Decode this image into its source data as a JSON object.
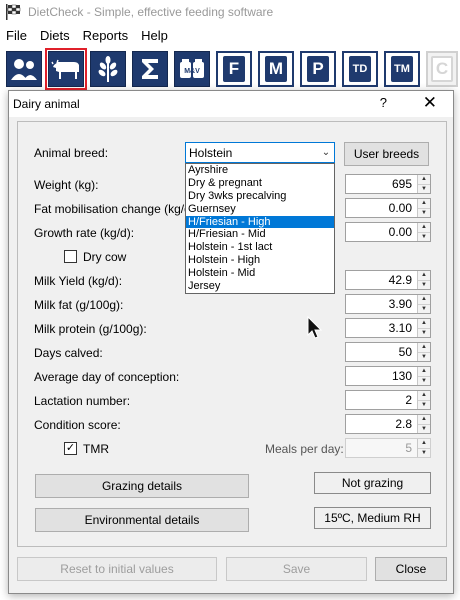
{
  "app": {
    "title": "DietCheck - Simple, effective feeding software",
    "menu": [
      "File",
      "Diets",
      "Reports",
      "Help"
    ]
  },
  "toolbar": {
    "buttons": [
      {
        "name": "users-icon"
      },
      {
        "name": "cow-icon",
        "selected": true
      },
      {
        "name": "crop-icon"
      },
      {
        "name": "sigma-icon"
      },
      {
        "name": "minerals-vitamins-icon",
        "label": "M&V"
      },
      {
        "name": "letter-f",
        "label": "F"
      },
      {
        "name": "letter-m",
        "label": "M"
      },
      {
        "name": "letter-p",
        "label": "P"
      },
      {
        "name": "letter-td",
        "label": "TD"
      },
      {
        "name": "letter-tm",
        "label": "TM"
      },
      {
        "name": "letter-c",
        "label": "C",
        "disabled": true
      }
    ]
  },
  "dialog": {
    "title": "Dairy animal",
    "help": "?",
    "close": "✕",
    "breed_label": "Animal breed:",
    "breed_value": "Holstein",
    "user_breeds": "User breeds",
    "breed_options": [
      "Ayrshire",
      "Dry & pregnant",
      "Dry 3wks precalving",
      "Guernsey",
      "H/Friesian - High",
      "H/Friesian - Mid",
      "Holstein - 1st lact",
      "Holstein - High",
      "Holstein - Mid",
      "Jersey"
    ],
    "highlighted_option": "H/Friesian - High",
    "fields": {
      "weight": {
        "label": "Weight (kg):",
        "value": "695"
      },
      "fat_mob": {
        "label": "Fat mobilisation change (kg/d):",
        "value": "0.00"
      },
      "growth": {
        "label": "Growth rate (kg/d):",
        "value": "0.00"
      },
      "dry_cow": "Dry cow",
      "milk_yield": {
        "label": "Milk Yield (kg/d):",
        "value": "42.9"
      },
      "milk_fat": {
        "label": "Milk fat (g/100g):",
        "value": "3.90"
      },
      "milk_protein": {
        "label": "Milk protein (g/100g):",
        "value": "3.10"
      },
      "days_calved": {
        "label": "Days calved:",
        "value": "50"
      },
      "avg_conception": {
        "label": "Average day of conception:",
        "value": "130"
      },
      "lactation": {
        "label": "Lactation number:",
        "value": "2"
      },
      "condition": {
        "label": "Condition score:",
        "value": "2.8"
      },
      "tmr": "TMR",
      "meals": {
        "label": "Meals per day:",
        "value": "5"
      }
    },
    "grazing_details": "Grazing details",
    "grazing_status": "Not grazing",
    "env_details": "Environmental details",
    "env_status": "15ºC, Medium RH",
    "reset": "Reset to initial values",
    "save": "Save",
    "close_btn": "Close"
  }
}
